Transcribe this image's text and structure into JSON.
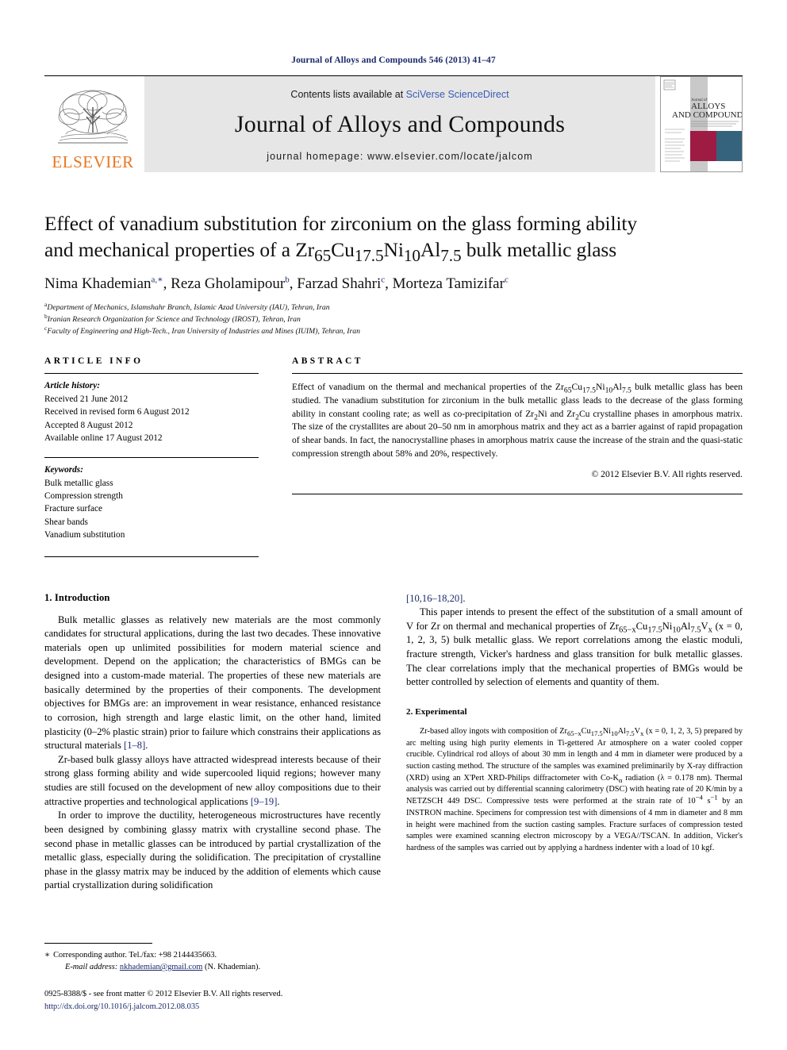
{
  "running_head": "Journal of Alloys and Compounds 546 (2013) 41–47",
  "masthead": {
    "contents_prefix": "Contents lists available at ",
    "contents_link": "SciVerse ScienceDirect",
    "journal_name": "Journal of Alloys and Compounds",
    "homepage": "journal homepage: www.elsevier.com/locate/jalcom",
    "publisher_logo_text": "ELSEVIER",
    "cover_lines": {
      "top": "Journal of",
      "l1": "ALLOYS",
      "l2": "AND COMPOUNDS"
    }
  },
  "article": {
    "title_line1": "Effect of vanadium substitution for zirconium on the glass forming ability",
    "title_line2_a": "and mechanical properties of a Zr",
    "title_sub1": "65",
    "title_line2_b": "Cu",
    "title_sub2": "17.5",
    "title_line2_c": "Ni",
    "title_sub3": "10",
    "title_line2_d": "Al",
    "title_sub4": "7.5",
    "title_line2_e": " bulk metallic glass",
    "authors": [
      {
        "name": "Nima Khademian",
        "marks": "a,∗",
        "sep": ", "
      },
      {
        "name": "Reza Gholamipour",
        "marks": "b",
        "sep": ", "
      },
      {
        "name": "Farzad Shahri",
        "marks": "c",
        "sep": ", "
      },
      {
        "name": "Morteza Tamizifar",
        "marks": "c",
        "sep": ""
      }
    ],
    "affiliations": [
      {
        "mark": "a",
        "text": "Department of Mechanics, Islamshahr Branch, Islamic Azad University (IAU), Tehran, Iran"
      },
      {
        "mark": "b",
        "text": "Iranian Research Organization for Science and Technology (IROST), Tehran, Iran"
      },
      {
        "mark": "c",
        "text": "Faculty of Engineering and High-Tech., Iran University of Industries and Mines (IUIM), Tehran, Iran"
      }
    ]
  },
  "article_info": {
    "heading": "ARTICLE INFO",
    "history_label": "Article history:",
    "history": [
      "Received 21 June 2012",
      "Received in revised form 6 August 2012",
      "Accepted 8 August 2012",
      "Available online 17 August 2012"
    ],
    "keywords_label": "Keywords:",
    "keywords": [
      "Bulk metallic glass",
      "Compression strength",
      "Fracture surface",
      "Shear bands",
      "Vanadium substitution"
    ]
  },
  "abstract": {
    "heading": "ABSTRACT",
    "p1_a": "Effect of vanadium on the thermal and mechanical properties of the Zr",
    "p1_sub1": "65",
    "p1_b": "Cu",
    "p1_sub2": "17.5",
    "p1_c": "Ni",
    "p1_sub3": "10",
    "p1_d": "Al",
    "p1_sub4": "7.5",
    "p1_e": " bulk metallic glass has been studied. The vanadium substitution for zirconium in the bulk metallic glass leads to the decrease of the glass forming ability in constant cooling rate; as well as co-precipitation of Zr",
    "p1_sub5": "2",
    "p1_f": "Ni and Zr",
    "p1_sub6": "2",
    "p1_g": "Cu crystalline phases in amorphous matrix. The size of the crystallites are about 20–50 nm in amorphous matrix and they act as a barrier against of rapid propagation of shear bands. In fact, the nanocrystalline phases in amorphous matrix cause the increase of the strain and the quasi-static compression strength about 58% and 20%, respectively.",
    "copyright": "© 2012 Elsevier B.V. All rights reserved."
  },
  "sections": {
    "introduction": {
      "heading": "1. Introduction",
      "p1": "Bulk metallic glasses as relatively new materials are the most commonly candidates for structural applications, during the last two decades. These innovative materials open up unlimited possibilities for modern material science and development. Depend on the application; the characteristics of BMGs can be designed into a custom-made material. The properties of these new materials are basically determined by the properties of their components. The development objectives for BMGs are: an improvement in wear resistance, enhanced resistance to corrosion, high strength and large elastic limit, on the other hand, limited plasticity (0–2% plastic strain) prior to failure which constrains their applications as structural materials ",
      "p1_ref": "[1–8]",
      "p1_end": ".",
      "p2": "Zr-based bulk glassy alloys have attracted widespread interests because of their strong glass forming ability and wide supercooled liquid regions; however many studies are still focused on the development of new alloy compositions due to their attractive properties and technological applications ",
      "p2_ref": "[9–19]",
      "p2_end": ".",
      "p3": "In order to improve the ductility, heterogeneous microstructures have recently been designed by combining glassy matrix with crystalline second phase. The second phase in metallic glasses can be introduced by partial crystallization of the metallic glass, especially during the solidification. The precipitation of crystalline phase in the glassy matrix may be induced by the addition of elements which cause partial crystallization during solidification ",
      "p3_ref": "[10,16–18,20]",
      "p3_end": ".",
      "p4_a": "This paper intends to present the effect of the substitution of a small amount of V for Zr on thermal and mechanical properties of Zr",
      "p4_sub1": "65−x",
      "p4_b": "Cu",
      "p4_sub2": "17.5",
      "p4_c": "Ni",
      "p4_sub3": "10",
      "p4_d": "Al",
      "p4_sub4": "7.5",
      "p4_e": "V",
      "p4_sub5": "x",
      "p4_f": " (x = 0, 1, 2, 3, 5) bulk metallic glass. We report correlations among the elastic moduli, fracture strength, Vicker's hardness and glass transition for bulk metallic glasses. The clear correlations imply that the mechanical properties of BMGs would be better controlled by selection of elements and quantity of them."
    },
    "experimental": {
      "heading": "2. Experimental",
      "p1_a": "Zr-based alloy ingots with composition of Zr",
      "p1_sub1": "65−x",
      "p1_b": "Cu",
      "p1_sub2": "17.5",
      "p1_c": "Ni",
      "p1_sub3": "10",
      "p1_d": "Al",
      "p1_sub4": "7.5",
      "p1_e": "V",
      "p1_sub5": "x",
      "p1_f": " (x = 0, 1, 2, 3, 5) prepared by arc melting using high purity elements in Ti-gettered Ar atmosphere on a water cooled copper crucible. Cylindrical rod alloys of about 30 mm in length and 4 mm in diameter were produced by a suction casting method. The structure of the samples was examined preliminarily by X-ray diffraction (XRD) using an X'Pert XRD-Philips diffractometer with Co-K",
      "p1_subA": "α",
      "p1_g": " radiation (λ = 0.178 nm). Thermal analysis was carried out by differential scanning calorimetry (DSC) with heating rate of 20 K/min by a NETZSCH 449 DSC. Compressive tests were performed at the strain rate of 10",
      "p1_supA": "−4",
      "p1_h": " s",
      "p1_supB": "−1",
      "p1_i": " by an INSTRON machine. Specimens for compression test with dimensions of 4 mm in diameter and 8 mm in height were machined from the suction casting samples. Fracture surfaces of compression tested samples were examined scanning electron microscopy by a VEGA//TSCAN. In addition, Vicker's hardness of the samples was carried out by applying a hardness indenter with a load of 10 kgf."
    }
  },
  "footnotes": {
    "corresponding_star": "∗",
    "corresponding": "Corresponding author. Tel./fax: +98 2144435663.",
    "email_label": "E-mail address:",
    "email": "nkhademian@gmail.com",
    "email_suffix": " (N. Khademian).",
    "issn_line": "0925-8388/$ - see front matter © 2012 Elsevier B.V. All rights reserved.",
    "doi": "http://dx.doi.org/10.1016/j.jalcom.2012.08.035"
  },
  "colors": {
    "link_blue": "#3b5bb5",
    "navy": "#1b2a6b",
    "elsevier_orange": "#E87722",
    "band_gray": "#e6e6e6",
    "cover_maroon": "#9e1b44",
    "cover_teal": "#35637d"
  }
}
